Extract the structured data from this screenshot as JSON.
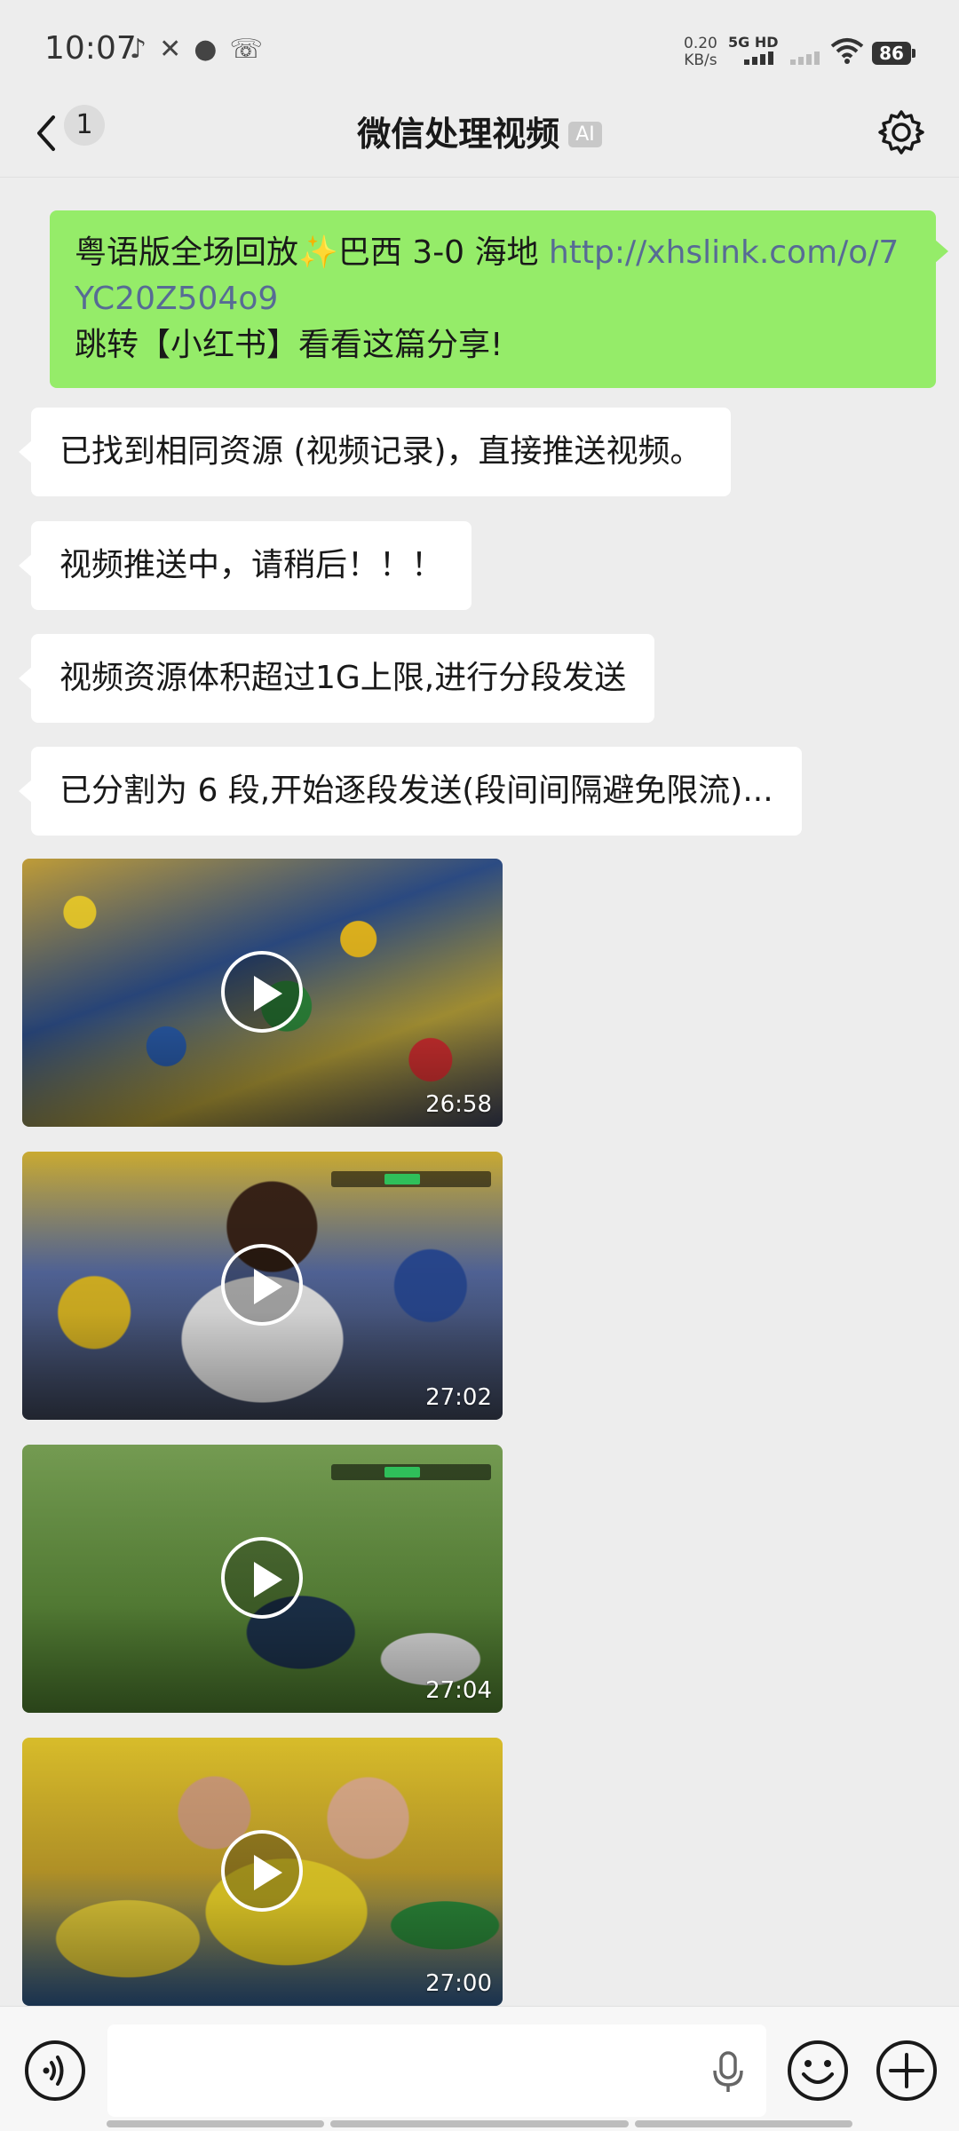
{
  "status_bar": {
    "time": "10:07",
    "net_speed_value": "0.20",
    "net_speed_unit": "KB/s",
    "network": "5G HD",
    "battery": "86"
  },
  "nav": {
    "unread_count": "1",
    "title": "微信处理视频",
    "ai_tag": "AI"
  },
  "messages": {
    "sent": {
      "text_before_emoji": "粤语版全场回放",
      "emoji": "✨",
      "text_after_emoji": "巴西 3-0 海地 ",
      "link": "http://xhslink.com/o/7YC20Z504o9",
      "line2": "跳转【小红书】看看这篇分享!"
    },
    "received": [
      {
        "text": "已找到相同资源 (视频记录)，直接推送视频。"
      },
      {
        "text": "视频推送中，请稍后！！！"
      },
      {
        "text": "视频资源体积超过1G上限,进行分段发送"
      },
      {
        "text": "已分割为 6 段,开始逐段发送(段间间隔避免限流)..."
      }
    ],
    "videos": [
      {
        "duration": "26:58"
      },
      {
        "duration": "27:02"
      },
      {
        "duration": "27:04"
      },
      {
        "duration": "27:00"
      }
    ]
  },
  "input": {
    "placeholder": ""
  },
  "colors": {
    "bubble_sent": "#95ec69",
    "bubble_received": "#ffffff",
    "background": "#ededed",
    "link": "#576b95"
  }
}
